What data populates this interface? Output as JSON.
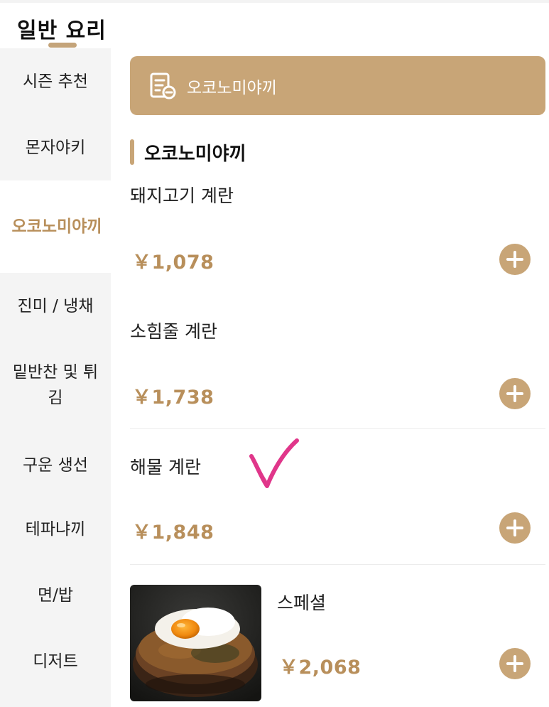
{
  "header": {
    "title": "일반 요리"
  },
  "sidebar": {
    "items": [
      {
        "label": "시즌 추천"
      },
      {
        "label": "몬자야키"
      },
      {
        "label": "오코노미야끼"
      },
      {
        "label": "진미 / 냉채"
      },
      {
        "label": "밑반찬 및 튀김"
      },
      {
        "label": "구운 생선"
      },
      {
        "label": "테파냐끼"
      },
      {
        "label": "면/밥"
      },
      {
        "label": "디저트"
      }
    ]
  },
  "banner": {
    "label": "오코노미야끼"
  },
  "section": {
    "title": "오코노미야끼"
  },
  "menu": {
    "items": [
      {
        "name": "돼지고기 계란",
        "price": "￥1,078"
      },
      {
        "name": "소힘줄 계란",
        "price": "￥1,738"
      },
      {
        "name": "해물 계란",
        "price": "￥1,848"
      },
      {
        "name": "스페셜",
        "price": "￥2,068"
      }
    ]
  },
  "colors": {
    "accent": "#c8a577",
    "price": "#b88f5b",
    "sidebar_bg": "#f4f4f4",
    "checkmark": "#e0368a"
  },
  "icons": {
    "banner": "menu-list-icon",
    "add": "plus-circle-icon"
  }
}
